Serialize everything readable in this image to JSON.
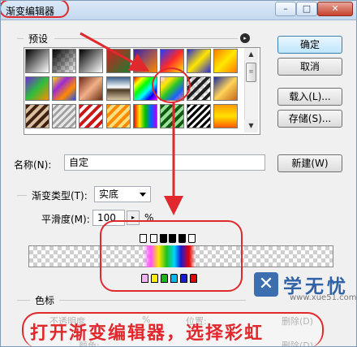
{
  "window": {
    "title": "渐变编辑器",
    "minimize_glyph": "–",
    "maximize_glyph": "□",
    "close_glyph": "✕"
  },
  "presets": {
    "label": "预设",
    "menu_glyph": "▸",
    "scroll_up_glyph": "▲",
    "scroll_down_glyph": "▼",
    "scroll_thumb_glyph": "≡",
    "swatches": [
      {
        "name": "foreground-to-background",
        "css": "linear-gradient(135deg,#000000,#ffffff)"
      },
      {
        "name": "foreground-to-transparent",
        "css": "linear-gradient(135deg,rgba(0,0,0,1),rgba(255,255,255,0))",
        "checker": true
      },
      {
        "name": "black-white",
        "css": "linear-gradient(135deg,#000000,#ffffff)"
      },
      {
        "name": "red-green",
        "css": "linear-gradient(135deg,#d01f1f,#1e7b2f)"
      },
      {
        "name": "violet-orange",
        "css": "linear-gradient(135deg,#3b1fb0,#ff8a00)"
      },
      {
        "name": "blue-red-yellow",
        "css": "linear-gradient(135deg,#1e3cff,#ff2a2a,#ffe600)"
      },
      {
        "name": "blue-yellow-blue",
        "css": "linear-gradient(135deg,#2b2bd8,#ffe600,#2b2bd8)"
      },
      {
        "name": "orange-yellow-orange",
        "css": "linear-gradient(135deg,#ff7b00,#ffe800,#ff7b00)"
      },
      {
        "name": "violet-green-orange",
        "css": "linear-gradient(135deg,#6d2bd6,#2fbf3b,#ff8b00)"
      },
      {
        "name": "yellow-violet-orange-blue",
        "css": "linear-gradient(135deg,#ffe100,#9a2bd6,#ff8a00,#2350e8)"
      },
      {
        "name": "copper",
        "css": "linear-gradient(135deg,#6a2b12,#f3b18a,#6a2b12)"
      },
      {
        "name": "chrome",
        "css": "linear-gradient(180deg,#3a5f8a,#ffffff 45%,#4a3a22 55%,#d9c6a8)"
      },
      {
        "name": "spectrum",
        "css": "linear-gradient(135deg,#ff0000,#ffff00,#00ff00,#00ffff,#0000ff,#ff00ff)"
      },
      {
        "name": "transparent-rainbow",
        "css": "linear-gradient(135deg,rgba(255,0,255,0.2),#ffe600,#26c12c,#1f5fff,rgba(255,0,0,0.4))",
        "checker": true
      },
      {
        "name": "transparent-stripes",
        "css": "repeating-linear-gradient(135deg,#1f1f1f 0 4px,rgba(255,255,255,0) 4px 8px)",
        "checker": true
      },
      {
        "name": "blue-gold",
        "css": "linear-gradient(135deg,#1f2f9a,#ffd35a,#c7681a)"
      },
      {
        "name": "dark-stripes",
        "css": "repeating-linear-gradient(135deg,#402010 0 4px,#d9c0a0 4px 8px)"
      },
      {
        "name": "soft-stripes",
        "css": "repeating-linear-gradient(135deg,#e8e8e8 0 3px,#a0a0a0 3px 6px)",
        "checker": true
      },
      {
        "name": "red-stripes",
        "css": "repeating-linear-gradient(135deg,#cc1515 0 4px,#ffffff 4px 8px)"
      },
      {
        "name": "orange-stripes",
        "css": "repeating-linear-gradient(135deg,#ff8a00 0 4px,#ffe080 4px 8px)"
      },
      {
        "name": "multi-rainbow",
        "css": "linear-gradient(90deg,#ff0000,#ffee00,#00c000,#0066ff,#aa00ff)"
      },
      {
        "name": "green-stripes",
        "css": "repeating-linear-gradient(135deg,#0f5a0f 0 4px,#9be09b 4px 8px)"
      },
      {
        "name": "black-white-stripes",
        "css": "repeating-linear-gradient(135deg,#000000 0 3px,#ffffff 3px 6px)"
      },
      {
        "name": "blue-purple-yellow",
        "css": "linear-gradient(180deg,#ff9a00,#ffe000 50%,#ff5a00)"
      }
    ]
  },
  "buttons": {
    "ok": "确定",
    "cancel": "取消",
    "load": "载入(L)...",
    "save": "存储(S)...",
    "new": "新建(W)"
  },
  "name": {
    "label": "名称(N):",
    "value": "自定"
  },
  "gradient_type": {
    "label": "渐变类型(T):",
    "value": "实底"
  },
  "smoothness": {
    "label": "平滑度(M):",
    "value": "100",
    "unit": "%"
  },
  "stops_section": {
    "label": "色标",
    "opacity_label": "不透明度",
    "opacity_unit": "%",
    "location_label": "位置:",
    "delete_label": "删除(D)",
    "color_label": "颜色:",
    "delete_label_2": "删除(D)"
  },
  "bottom_stop_colors": [
    "#f7b2f7",
    "#ffee00",
    "#19b519",
    "#00b8f0",
    "#1a1ad8",
    "#e00000"
  ],
  "annotation": {
    "text": "打开渐变编辑器，选择彩虹"
  },
  "watermark": {
    "logo_glyph": "✕",
    "title": "学无忧",
    "url": "www.xue51.com"
  },
  "colors": {
    "annotation_red": "#e0282d",
    "title_bg": "#dce9f7",
    "dialog_bg": "#f0f0f0"
  }
}
